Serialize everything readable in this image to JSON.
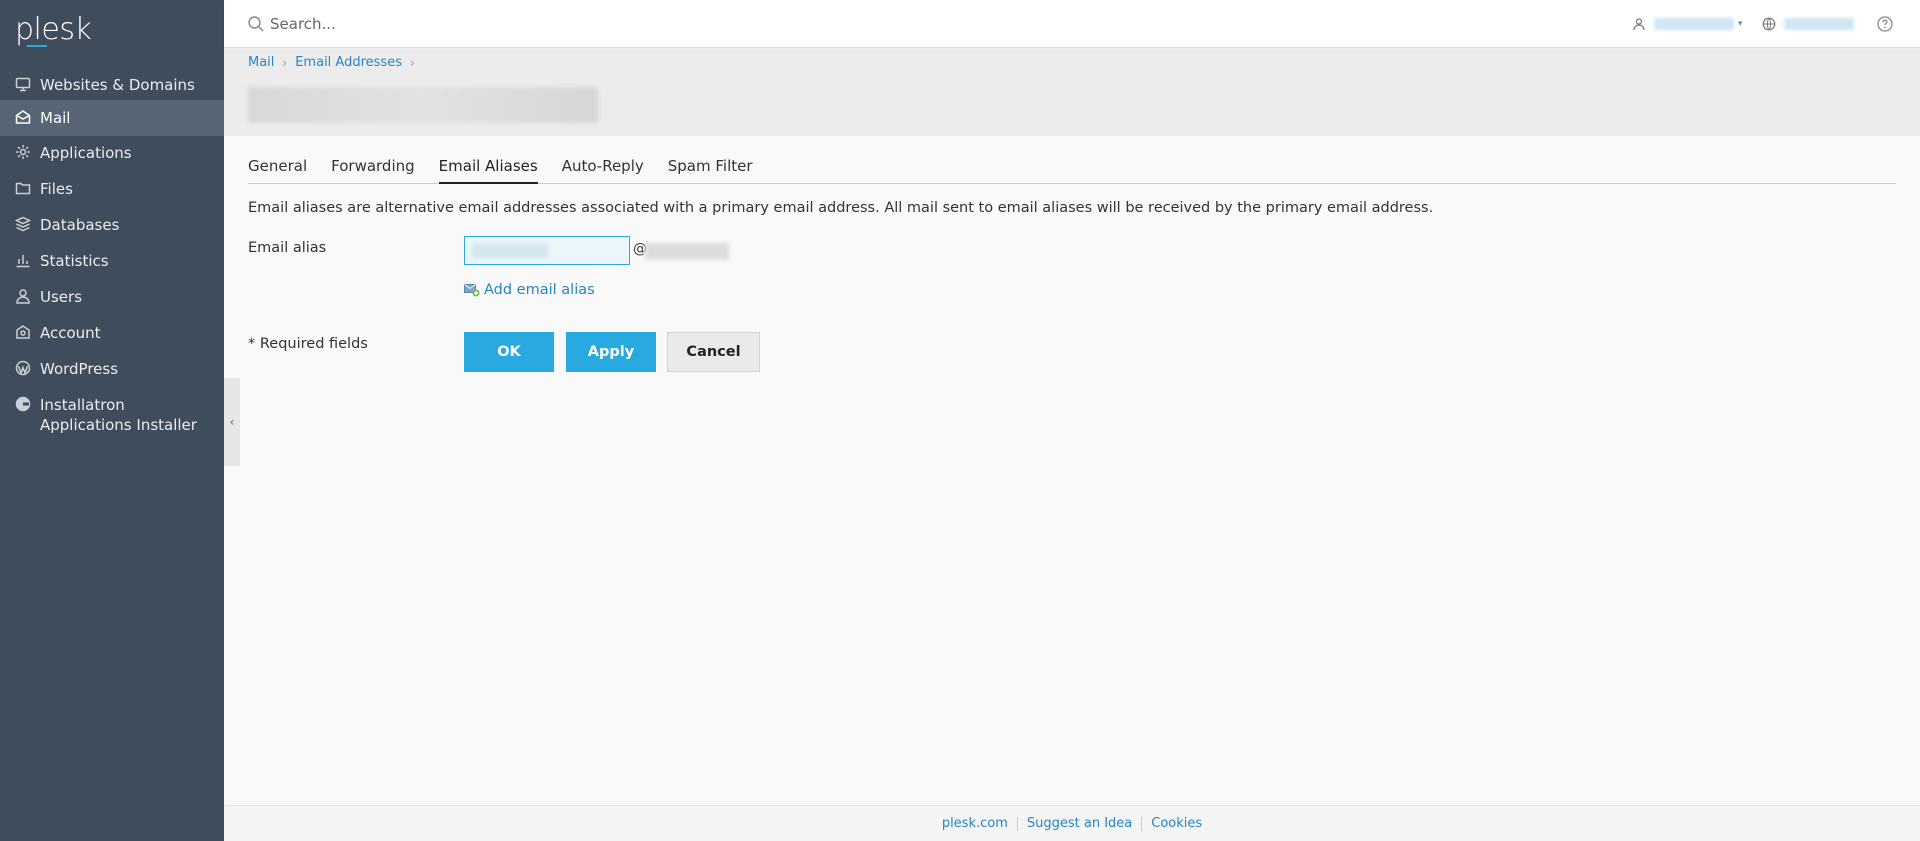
{
  "app": {
    "logo": "plesk"
  },
  "sidebar": {
    "items": [
      {
        "label": "Websites & Domains",
        "icon": "monitor-icon",
        "active": false
      },
      {
        "label": "Mail",
        "icon": "mail-icon",
        "active": true
      },
      {
        "label": "Applications",
        "icon": "gear-icon",
        "active": false
      },
      {
        "label": "Files",
        "icon": "folder-icon",
        "active": false
      },
      {
        "label": "Databases",
        "icon": "layers-icon",
        "active": false
      },
      {
        "label": "Statistics",
        "icon": "bar-chart-icon",
        "active": false
      },
      {
        "label": "Users",
        "icon": "user-icon",
        "active": false
      },
      {
        "label": "Account",
        "icon": "account-icon",
        "active": false
      },
      {
        "label": "WordPress",
        "icon": "wordpress-icon",
        "active": false
      },
      {
        "label": "Installatron Applications Installer",
        "icon": "installatron-icon",
        "active": false
      }
    ]
  },
  "topbar": {
    "search_placeholder": "Search..."
  },
  "breadcrumb": {
    "items": [
      "Mail",
      "Email Addresses"
    ]
  },
  "tabs": [
    {
      "label": "General",
      "active": false
    },
    {
      "label": "Forwarding",
      "active": false
    },
    {
      "label": "Email Aliases",
      "active": true
    },
    {
      "label": "Auto-Reply",
      "active": false
    },
    {
      "label": "Spam Filter",
      "active": false
    }
  ],
  "form": {
    "description": "Email aliases are alternative email addresses associated with a primary email address. All mail sent to email aliases will be received by the primary email address.",
    "alias_label": "Email alias",
    "at_sign": "@",
    "add_alias_label": "Add email alias",
    "required_note": "* Required fields",
    "ok_label": "OK",
    "apply_label": "Apply",
    "cancel_label": "Cancel"
  },
  "footer": {
    "links": [
      "plesk.com",
      "Suggest an Idea",
      "Cookies"
    ]
  },
  "colors": {
    "sidebar_bg": "#3f4c5c",
    "sidebar_active": "#566574",
    "primary_button": "#28a9e0",
    "link": "#2785c3"
  }
}
